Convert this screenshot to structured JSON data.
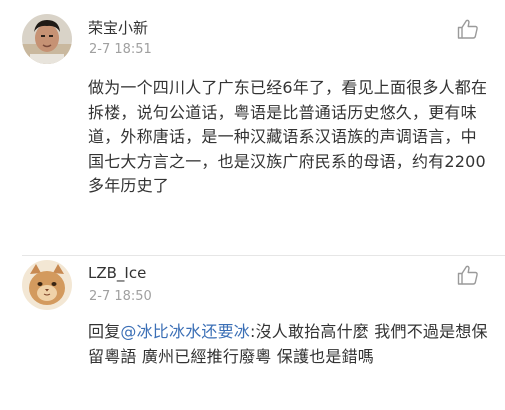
{
  "comments": [
    {
      "username": "荣宝小新",
      "timestamp": "2-7 18:51",
      "text": "做为一个四川人了广东已经6年了，看见上面很多人都在拆楼，说句公道话，粤语是比普通话历史悠久，更有味道，外称唐话，是一种汉藏语系汉语族的声调语言，中国七大方言之一，也是汉族广府民系的母语，约有2200多年历史了",
      "like_icon": "thumbs-up-outline-icon"
    },
    {
      "username": "LZB_Ice",
      "timestamp": "2-7 18:50",
      "reply_prefix": "回复",
      "mention": "@冰比冰水还要冰",
      "text": ":沒人敢抬高什麼 我們不過是想保留粵語  廣州已經推行廢粵 保護也是錯嗎",
      "like_icon": "thumbs-up-outline-icon"
    }
  ],
  "colors": {
    "text": "#333333",
    "timestamp": "#a0a0a0",
    "mention": "#3b6fb6",
    "divider": "#e6e6e6",
    "icon": "#9a9a9a"
  }
}
